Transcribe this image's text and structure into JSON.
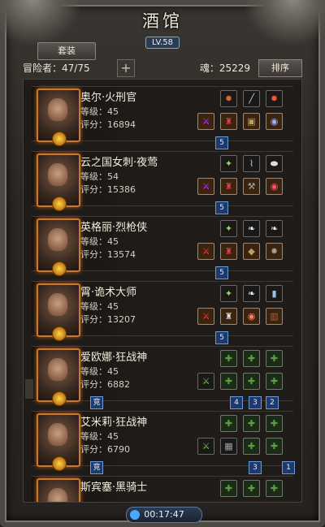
{
  "header": {
    "title": "酒馆",
    "level": "LV.58"
  },
  "toolbar": {
    "outfit_label": "套装",
    "add_label": "+",
    "sort_label": "排序"
  },
  "stats": {
    "adventurers": "冒险者：47/75",
    "soul": "魂：25229"
  },
  "heroes": [
    {
      "name": "奥尔·火刑官",
      "level": "等级：45",
      "score": "评分：16894",
      "badges": [
        "5"
      ],
      "slots": [
        "fire",
        "sword",
        "fire",
        "potion",
        "pot",
        "pot",
        "pot",
        "pot"
      ]
    },
    {
      "name": "云之国女刺·夜莺",
      "level": "等级：54",
      "score": "评分：15386",
      "badges": [
        "5"
      ],
      "slots": [
        "leaf",
        "sword",
        "potion",
        "pot",
        "pot",
        "pot",
        "pot",
        "pot"
      ]
    },
    {
      "name": "英格丽·烈枪侠",
      "level": "等级：45",
      "score": "评分：13574",
      "badges": [
        "5"
      ],
      "slots": [
        "leaf",
        "wing",
        "wing",
        "pot",
        "pot",
        "pot",
        "pot",
        "pot"
      ]
    },
    {
      "name": "霄·诡术大师",
      "level": "等级：45",
      "score": "评分：13207",
      "badges": [
        "5"
      ],
      "slots": [
        "leaf",
        "wing",
        "potion",
        "pot",
        "pot",
        "pot",
        "pot",
        "pot"
      ]
    },
    {
      "name": "爱欧娜·狂战神",
      "level": "等级：45",
      "score": "评分：6882",
      "badges": [
        "4",
        "3",
        "2"
      ],
      "tag": "竞",
      "slots": [
        "leaf",
        "leaf",
        "leaf",
        "sword",
        "leaf",
        "leaf",
        "leaf",
        "leaf"
      ]
    },
    {
      "name": "艾米莉·狂战神",
      "level": "等级：45",
      "score": "评分：6790",
      "badges": [
        "3",
        "1"
      ],
      "tag": "竞",
      "slots": [
        "leaf",
        "leaf",
        "leaf",
        "sword",
        "leaf",
        "leaf",
        "leaf",
        "leaf"
      ]
    },
    {
      "name": "斯宾塞·黑骑士",
      "level": "",
      "score": "",
      "badges": [],
      "slots": [
        "leaf",
        "leaf",
        "leaf"
      ]
    }
  ],
  "timer": "00:17:47",
  "colors": {
    "accent": "#c87a2c",
    "badge": "#1f3a6a"
  }
}
